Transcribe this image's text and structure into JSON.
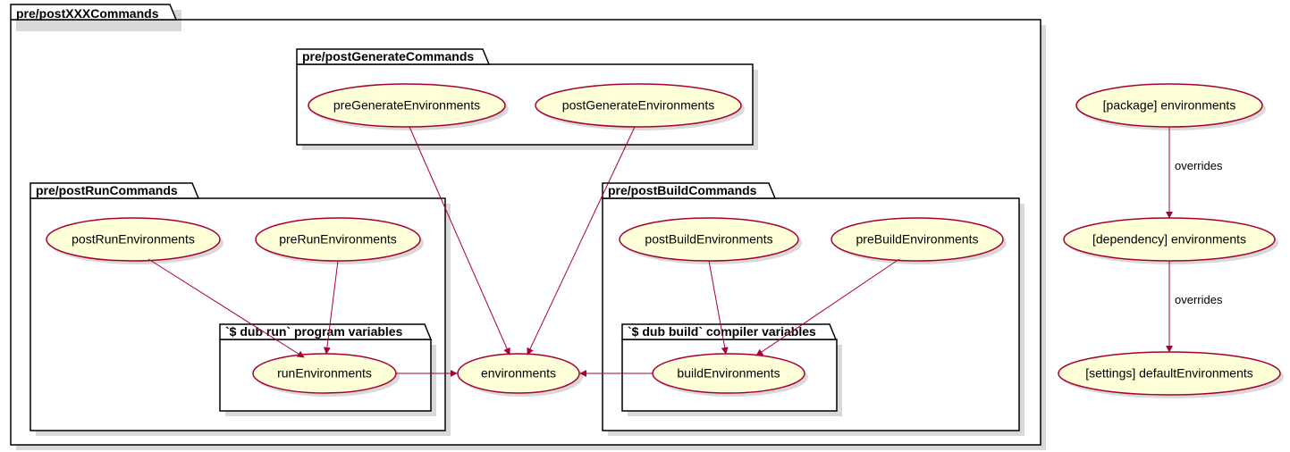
{
  "packages": {
    "outer": {
      "label": "pre/postXXXCommands"
    },
    "gen": {
      "label": "pre/postGenerateCommands"
    },
    "run": {
      "label": "pre/postRunCommands"
    },
    "build": {
      "label": "pre/postBuildCommands"
    },
    "runVars": {
      "label": "`$ dub run` program variables"
    },
    "buildVars": {
      "label": "`$ dub build` compiler variables"
    }
  },
  "nodes": {
    "preGen": {
      "label": "preGenerateEnvironments"
    },
    "postGen": {
      "label": "postGenerateEnvironments"
    },
    "postRun": {
      "label": "postRunEnvironments"
    },
    "preRun": {
      "label": "preRunEnvironments"
    },
    "postBuild": {
      "label": "postBuildEnvironments"
    },
    "preBuild": {
      "label": "preBuildEnvironments"
    },
    "runEnv": {
      "label": "runEnvironments"
    },
    "buildEnv": {
      "label": "buildEnvironments"
    },
    "env": {
      "label": "environments"
    },
    "pkgEnv": {
      "label": "[package] environments"
    },
    "depEnv": {
      "label": "[dependency] environments"
    },
    "defEnv": {
      "label": "[settings] defaultEnvironments"
    }
  },
  "edges": {
    "ov1": {
      "label": "overrides"
    },
    "ov2": {
      "label": "overrides"
    }
  },
  "chart_data": {
    "type": "diagram",
    "layout": [
      {
        "package": "pre/postXXXCommands",
        "contains": [
          {
            "package": "pre/postGenerateCommands",
            "contains": [
              "preGenerateEnvironments",
              "postGenerateEnvironments"
            ]
          },
          {
            "package": "pre/postRunCommands",
            "contains": [
              "postRunEnvironments",
              "preRunEnvironments",
              {
                "package": "`$ dub run` program variables",
                "contains": [
                  "runEnvironments"
                ]
              }
            ]
          },
          {
            "package": "pre/postBuildCommands",
            "contains": [
              "postBuildEnvironments",
              "preBuildEnvironments",
              {
                "package": "`$ dub build` compiler variables",
                "contains": [
                  "buildEnvironments"
                ]
              }
            ]
          },
          "environments"
        ]
      },
      "[package] environments",
      "[dependency] environments",
      "[settings] defaultEnvironments"
    ],
    "arrows": [
      {
        "from": "preGenerateEnvironments",
        "to": "environments"
      },
      {
        "from": "postGenerateEnvironments",
        "to": "environments"
      },
      {
        "from": "postRunEnvironments",
        "to": "runEnvironments"
      },
      {
        "from": "preRunEnvironments",
        "to": "runEnvironments"
      },
      {
        "from": "runEnvironments",
        "to": "environments"
      },
      {
        "from": "postBuildEnvironments",
        "to": "buildEnvironments"
      },
      {
        "from": "preBuildEnvironments",
        "to": "buildEnvironments"
      },
      {
        "from": "buildEnvironments",
        "to": "environments"
      },
      {
        "from": "[package] environments",
        "to": "[dependency] environments",
        "label": "overrides"
      },
      {
        "from": "[dependency] environments",
        "to": "[settings] defaultEnvironments",
        "label": "overrides"
      }
    ]
  }
}
